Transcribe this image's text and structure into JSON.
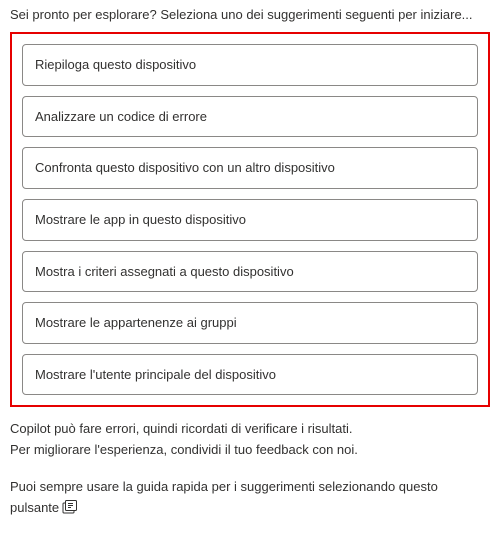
{
  "intro": "Sei pronto per esplorare? Seleziona uno dei suggerimenti seguenti per iniziare...",
  "suggestions": [
    {
      "label": "Riepiloga questo dispositivo"
    },
    {
      "label": "Analizzare un codice di errore"
    },
    {
      "label": "Confronta questo dispositivo con un altro dispositivo"
    },
    {
      "label": "Mostrare le app in questo dispositivo"
    },
    {
      "label": "Mostra i criteri assegnati a questo dispositivo"
    },
    {
      "label": "Mostrare le appartenenze ai gruppi"
    },
    {
      "label": "Mostrare l'utente principale del dispositivo"
    }
  ],
  "disclaimer_line1": "Copilot può fare errori, quindi ricordati di verificare i risultati.",
  "disclaimer_line2": "Per migliorare l'esperienza, condividi il tuo feedback con noi.",
  "guide_text_part1": "Puoi sempre usare la guida rapida per i suggerimenti selezionando questo pulsante",
  "guide_icon_name": "prompt-guide-icon",
  "colors": {
    "highlight_border": "#e60000",
    "item_border": "#8a8886",
    "text": "#323130"
  }
}
